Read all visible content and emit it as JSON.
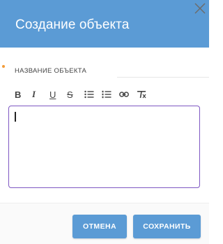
{
  "dialog": {
    "title": "Создание объекта",
    "close_icon": "close-icon"
  },
  "field": {
    "label": "НАЗВАНИЕ ОБЪЕКТА",
    "required": true,
    "value": ""
  },
  "toolbar": {
    "bold": "B",
    "italic": "I",
    "underline": "U",
    "strikethrough": "S",
    "icons": [
      "bold-icon",
      "italic-icon",
      "underline-icon",
      "strikethrough-icon",
      "bulleted-list-icon",
      "numbered-list-icon",
      "link-icon",
      "clear-format-icon"
    ]
  },
  "buttons": {
    "cancel": "ОТМЕНА",
    "save": "СОХРАНИТЬ"
  },
  "colors": {
    "header": "#5b9bd5",
    "button": "#5b9bd5",
    "editor_border": "#7e57c2",
    "required": "#f29b38"
  }
}
